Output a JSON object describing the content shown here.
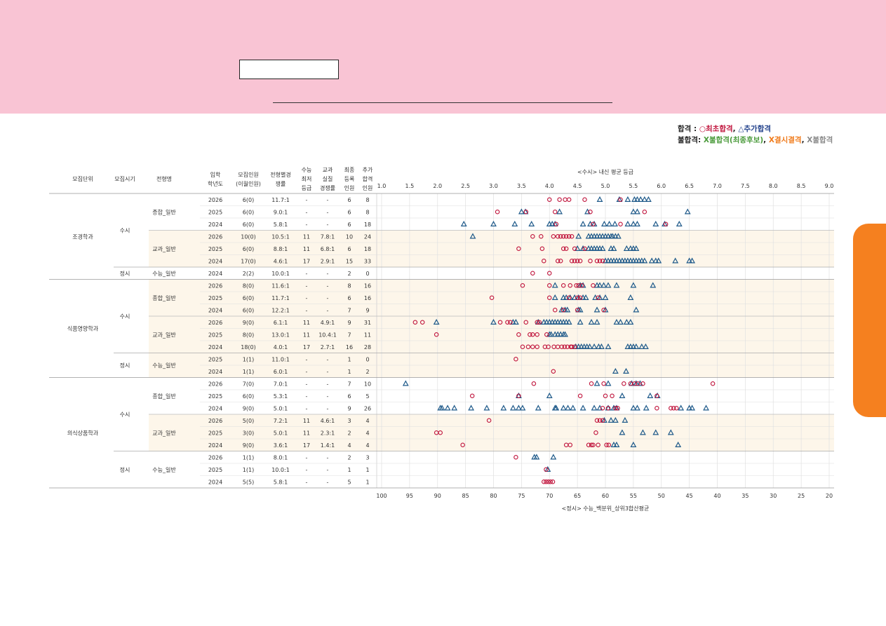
{
  "legend": {
    "pass_label": "합격",
    "pass_sep": " : ",
    "initial_pass": "○최초합격",
    "additional_pass": "△추가합격",
    "fail_label": "불합격",
    "fail_sep": ": ",
    "fail_waitlist": "X불합격(최종후보)",
    "fail_absent": "X결시결격",
    "fail_plain": "X불합격",
    "comma": ", "
  },
  "table_headers": {
    "unit": "모집단위",
    "period": "모집시기",
    "type": "전형명",
    "year": [
      "입학",
      "학년도"
    ],
    "quota": [
      "모집인원",
      "(이월인원)"
    ],
    "ratio": [
      "전형별경",
      "쟁률"
    ],
    "min_grade": [
      "수능",
      "최저",
      "등급"
    ],
    "real_ratio": [
      "교과",
      "실질",
      "경쟁률"
    ],
    "final": [
      "최종",
      "등록",
      "인원"
    ],
    "extra": [
      "추가",
      "합격",
      "인원"
    ]
  },
  "chart_data": {
    "type": "scatter",
    "title_top": "<수시> 내신 평균 등급",
    "title_bottom": "<정시> 수능_백분위_상위3합산평균",
    "x_top_ticks": [
      "1.0",
      "1.5",
      "2.0",
      "2.5",
      "3.0",
      "3.5",
      "4.0",
      "4.5",
      "5.0",
      "5.5",
      "6.0",
      "6.5",
      "7.0",
      "7.5",
      "8.0",
      "8.5",
      "9.0"
    ],
    "x_top_range": [
      1.0,
      9.0
    ],
    "x_bottom_ticks": [
      "100",
      "95",
      "90",
      "85",
      "80",
      "75",
      "70",
      "65",
      "60",
      "55",
      "50",
      "45",
      "40",
      "35",
      "30",
      "25",
      "20"
    ],
    "x_bottom_range": [
      100,
      20
    ],
    "marker_colors": {
      "initial": "#c0143c",
      "additional": "#1f5a8a"
    },
    "rows": [
      {
        "unit": "조경학과",
        "period": "수시",
        "type": "종합_일반",
        "year": "2026",
        "quota": "6(0)",
        "ratio": "11.7:1",
        "min": "-",
        "real": "-",
        "final": "6",
        "extra": "8",
        "scale": "grade",
        "initial": [
          4.0,
          4.18,
          4.28,
          4.35,
          4.63,
          5.27
        ],
        "additional": [
          4.9,
          5.25,
          5.4,
          5.52,
          5.57,
          5.63,
          5.7,
          5.77
        ]
      },
      {
        "unit": "조경학과",
        "period": "수시",
        "type": "종합_일반",
        "year": "2025",
        "quota": "6(0)",
        "ratio": "9.0:1",
        "min": "-",
        "real": "-",
        "final": "6",
        "extra": "8",
        "scale": "grade",
        "initial": [
          3.07,
          3.58,
          4.1,
          4.73,
          5.7
        ],
        "additional": [
          3.5,
          3.57,
          4.18,
          4.68,
          5.5,
          5.57,
          6.47
        ]
      },
      {
        "unit": "조경학과",
        "period": "수시",
        "type": "종합_일반",
        "year": "2024",
        "quota": "6(0)",
        "ratio": "5.8:1",
        "min": "-",
        "real": "-",
        "final": "6",
        "extra": "18",
        "scale": "grade",
        "initial": [
          4.12,
          4.78,
          5.27,
          6.08
        ],
        "additional": [
          2.47,
          3.0,
          3.38,
          3.68,
          4.0,
          4.05,
          4.1,
          4.6,
          4.73,
          4.8,
          4.98,
          5.07,
          5.17,
          5.4,
          5.5,
          5.57,
          5.9,
          6.06,
          6.32
        ]
      },
      {
        "unit": "조경학과",
        "period": "수시",
        "type": "교과_일반",
        "year": "2026",
        "quota": "10(0)",
        "ratio": "10.5:1",
        "min": "11",
        "real": "7.8:1",
        "final": "10",
        "extra": "24",
        "scale": "grade",
        "initial": [
          3.7,
          3.85,
          4.07,
          4.15,
          4.2,
          4.25,
          4.3,
          4.35,
          4.4
        ],
        "additional": [
          2.63,
          4.52,
          4.7,
          4.75,
          4.8,
          4.85,
          4.9,
          4.95,
          5.0,
          5.05,
          5.1,
          5.13,
          5.18,
          5.23
        ]
      },
      {
        "unit": "조경학과",
        "period": "수시",
        "type": "교과_일반",
        "year": "2025",
        "quota": "6(0)",
        "ratio": "8.8:1",
        "min": "11",
        "real": "6.8:1",
        "final": "6",
        "extra": "18",
        "scale": "grade",
        "initial": [
          3.45,
          3.87,
          4.25,
          4.3,
          4.45,
          4.63
        ],
        "additional": [
          4.5,
          4.6,
          4.7,
          4.75,
          4.8,
          4.85,
          4.9,
          4.95,
          5.1,
          5.15,
          5.38,
          5.45,
          5.5,
          5.55
        ]
      },
      {
        "unit": "조경학과",
        "period": "수시",
        "type": "교과_일반",
        "year": "2024",
        "quota": "17(0)",
        "ratio": "4.6:1",
        "min": "17",
        "real": "2.9:1",
        "final": "15",
        "extra": "33",
        "scale": "grade",
        "initial": [
          3.9,
          4.15,
          4.2,
          4.4,
          4.45,
          4.5,
          4.55,
          4.73,
          4.85,
          4.9,
          4.95
        ],
        "additional": [
          5.0,
          5.05,
          5.1,
          5.15,
          5.2,
          5.25,
          5.3,
          5.35,
          5.4,
          5.45,
          5.5,
          5.55,
          5.6,
          5.65,
          5.7,
          5.83,
          5.9,
          5.95,
          6.25,
          6.5,
          6.55
        ]
      },
      {
        "unit": "조경학과",
        "period": "정시",
        "type": "수능_일반",
        "year": "2024",
        "quota": "2(2)",
        "ratio": "10.0:1",
        "min": "-",
        "real": "-",
        "final": "2",
        "extra": "0",
        "scale": "pct",
        "initial": [
          73,
          70
        ],
        "additional": []
      },
      {
        "unit": "식품영양학과",
        "period": "수시",
        "type": "종합_일반",
        "year": "2026",
        "quota": "8(0)",
        "ratio": "11.6:1",
        "min": "-",
        "real": "-",
        "final": "8",
        "extra": "16",
        "scale": "grade",
        "initial": [
          3.52,
          4.0,
          4.25,
          4.37,
          4.48,
          4.52,
          4.58,
          4.78
        ],
        "additional": [
          4.1,
          4.55,
          4.6,
          4.85,
          4.9,
          4.97,
          5.05,
          5.2,
          5.5,
          5.85
        ]
      },
      {
        "unit": "식품영양학과",
        "period": "수시",
        "type": "종합_일반",
        "year": "2025",
        "quota": "6(0)",
        "ratio": "11.7:1",
        "min": "-",
        "real": "-",
        "final": "6",
        "extra": "16",
        "scale": "grade",
        "initial": [
          2.97,
          4.0,
          4.35,
          4.5,
          4.55,
          4.87
        ],
        "additional": [
          4.1,
          4.25,
          4.3,
          4.37,
          4.45,
          4.52,
          4.6,
          4.65,
          4.82,
          4.9,
          5.0,
          5.45
        ]
      },
      {
        "unit": "식품영양학과",
        "period": "수시",
        "type": "종합_일반",
        "year": "2024",
        "quota": "6(0)",
        "ratio": "12.2:1",
        "min": "-",
        "real": "-",
        "final": "7",
        "extra": "9",
        "scale": "grade",
        "initial": [
          4.1,
          4.25,
          4.5,
          4.97
        ],
        "additional": [
          4.22,
          4.28,
          4.32,
          4.52,
          4.55,
          4.85,
          5.0,
          5.55
        ]
      },
      {
        "unit": "식품영양학과",
        "period": "수시",
        "type": "교과_일반",
        "year": "2026",
        "quota": "9(0)",
        "ratio": "6.1:1",
        "min": "11",
        "real": "4.9:1",
        "final": "9",
        "extra": "31",
        "scale": "grade",
        "initial": [
          1.6,
          1.73,
          3.12,
          3.25,
          3.3,
          3.58,
          3.78,
          3.82
        ],
        "additional": [
          1.98,
          3.0,
          3.35,
          3.4,
          3.8,
          3.9,
          3.95,
          4.0,
          4.05,
          4.1,
          4.15,
          4.2,
          4.25,
          4.3,
          4.35,
          4.55,
          4.75,
          4.85,
          5.2,
          5.27,
          5.38,
          5.45
        ]
      },
      {
        "unit": "식품영양학과",
        "period": "수시",
        "type": "교과_일반",
        "year": "2025",
        "quota": "8(0)",
        "ratio": "13.0:1",
        "min": "11",
        "real": "10.4:1",
        "final": "7",
        "extra": "11",
        "scale": "grade",
        "initial": [
          1.98,
          3.45,
          3.65,
          3.7,
          3.78,
          3.95
        ],
        "additional": [
          4.0,
          4.03,
          4.1,
          4.15,
          4.2,
          4.25,
          4.28
        ]
      },
      {
        "unit": "식품영양학과",
        "period": "수시",
        "type": "교과_일반",
        "year": "2024",
        "quota": "18(0)",
        "ratio": "4.0:1",
        "min": "17",
        "real": "2.7:1",
        "final": "16",
        "extra": "28",
        "scale": "grade",
        "initial": [
          3.52,
          3.62,
          3.7,
          3.78,
          3.92,
          3.98,
          4.08,
          4.15,
          4.22,
          4.27,
          4.32,
          4.38,
          4.4,
          4.45
        ],
        "additional": [
          4.47,
          4.52,
          4.57,
          4.62,
          4.67,
          4.72,
          4.8,
          4.88,
          4.93,
          5.05,
          5.4,
          5.45,
          5.5,
          5.55,
          5.65,
          5.72
        ]
      },
      {
        "unit": "식품영양학과",
        "period": "정시",
        "type": "수능_일반",
        "year": "2025",
        "quota": "1(1)",
        "ratio": "11.0:1",
        "min": "-",
        "real": "-",
        "final": "1",
        "extra": "0",
        "scale": "pct",
        "initial": [
          76
        ],
        "additional": []
      },
      {
        "unit": "식품영양학과",
        "period": "정시",
        "type": "수능_일반",
        "year": "2024",
        "quota": "1(1)",
        "ratio": "6.0:1",
        "min": "-",
        "real": "-",
        "final": "1",
        "extra": "2",
        "scale": "pct",
        "initial": [
          69.3
        ],
        "additional": [
          58.2,
          56.3
        ]
      },
      {
        "unit": "의식상품학과",
        "period": "수시",
        "type": "종합_일반",
        "year": "2026",
        "quota": "7(0)",
        "ratio": "7.0:1",
        "min": "-",
        "real": "-",
        "final": "7",
        "extra": "10",
        "scale": "grade",
        "initial": [
          3.72,
          4.75,
          4.97,
          5.33,
          5.45,
          5.52,
          5.58,
          5.67,
          6.92
        ],
        "additional": [
          1.43,
          4.85,
          5.05,
          5.47,
          5.55,
          5.62
        ]
      },
      {
        "unit": "의식상품학과",
        "period": "수시",
        "type": "종합_일반",
        "year": "2025",
        "quota": "6(0)",
        "ratio": "5.3:1",
        "min": "-",
        "real": "-",
        "final": "6",
        "extra": "5",
        "scale": "grade",
        "initial": [
          2.62,
          3.45,
          4.55,
          5.0,
          5.12,
          5.92
        ],
        "additional": [
          3.45,
          4.0,
          5.3,
          5.8,
          5.93
        ]
      },
      {
        "unit": "의식상품학과",
        "period": "수시",
        "type": "종합_일반",
        "year": "2024",
        "quota": "9(0)",
        "ratio": "5.0:1",
        "min": "-",
        "real": "-",
        "final": "9",
        "extra": "26",
        "scale": "grade",
        "initial": [
          4.95,
          5.05,
          5.18,
          5.22,
          5.92,
          6.17,
          6.22,
          6.27
        ],
        "additional": [
          2.05,
          2.08,
          2.18,
          2.3,
          2.6,
          2.88,
          3.18,
          3.35,
          3.45,
          3.52,
          3.8,
          4.1,
          4.12,
          4.25,
          4.33,
          4.42,
          4.6,
          4.8,
          4.9,
          5.05,
          5.15,
          5.2,
          5.5,
          5.57,
          5.73,
          6.35,
          6.5,
          6.55,
          6.8
        ]
      },
      {
        "unit": "의식상품학과",
        "period": "수시",
        "type": "교과_일반",
        "year": "2026",
        "quota": "5(0)",
        "ratio": "7.2:1",
        "min": "11",
        "real": "4.6:1",
        "final": "3",
        "extra": "4",
        "scale": "grade",
        "initial": [
          2.92,
          4.85,
          4.9,
          4.95
        ],
        "additional": [
          4.98,
          5.1,
          5.18,
          5.35
        ]
      },
      {
        "unit": "의식상품학과",
        "period": "수시",
        "type": "교과_일반",
        "year": "2025",
        "quota": "3(0)",
        "ratio": "5.0:1",
        "min": "11",
        "real": "2.3:1",
        "final": "2",
        "extra": "4",
        "scale": "grade",
        "initial": [
          1.98,
          2.05,
          4.83
        ],
        "additional": [
          5.3,
          5.67,
          5.9,
          6.17
        ]
      },
      {
        "unit": "의식상품학과",
        "period": "수시",
        "type": "교과_일반",
        "year": "2024",
        "quota": "9(0)",
        "ratio": "3.6:1",
        "min": "17",
        "real": "1.4:1",
        "final": "4",
        "extra": "4",
        "scale": "grade",
        "initial": [
          2.45,
          4.3,
          4.37,
          4.7,
          4.75,
          4.78,
          4.87,
          5.02,
          5.06
        ],
        "additional": [
          5.15,
          5.2,
          5.5,
          6.3
        ]
      },
      {
        "unit": "의식상품학과",
        "period": "정시",
        "type": "수능_일반",
        "year": "2026",
        "quota": "1(1)",
        "ratio": "8.0:1",
        "min": "-",
        "real": "-",
        "final": "2",
        "extra": "3",
        "scale": "pct",
        "initial": [
          76
        ],
        "additional": [
          72.7,
          72.3,
          69.3
        ]
      },
      {
        "unit": "의식상품학과",
        "period": "정시",
        "type": "수능_일반",
        "year": "2025",
        "quota": "1(1)",
        "ratio": "10.0:1",
        "min": "-",
        "real": "-",
        "final": "1",
        "extra": "1",
        "scale": "pct",
        "initial": [
          70.6
        ],
        "additional": [
          70.3
        ]
      },
      {
        "unit": "의식상품학과",
        "period": "정시",
        "type": "수능_일반",
        "year": "2024",
        "quota": "5(5)",
        "ratio": "5.8:1",
        "min": "-",
        "real": "-",
        "final": "5",
        "extra": "1",
        "scale": "pct",
        "initial": [
          71,
          70.6,
          70.2,
          69.8,
          69.4
        ],
        "additional": []
      }
    ]
  }
}
